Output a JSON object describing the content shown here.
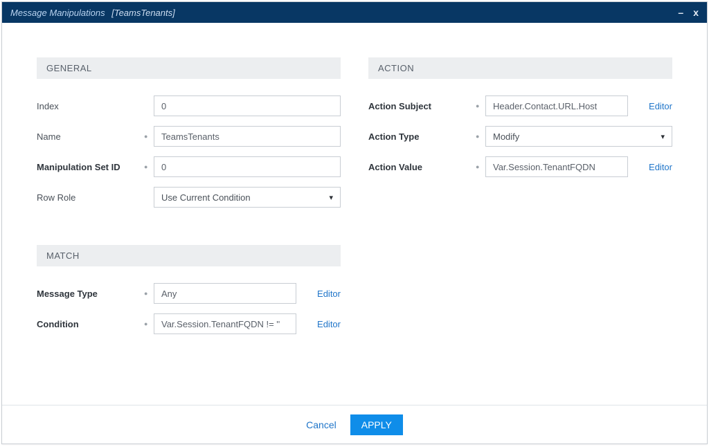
{
  "window": {
    "title": "Message Manipulations",
    "name": "[TeamsTenants]"
  },
  "sections": {
    "general": {
      "header": "GENERAL",
      "index_label": "Index",
      "index_value": "0",
      "name_label": "Name",
      "name_value": "TeamsTenants",
      "manip_id_label": "Manipulation Set ID",
      "manip_id_value": "0",
      "row_role_label": "Row Role",
      "row_role_value": "Use Current Condition"
    },
    "match": {
      "header": "MATCH",
      "message_type_label": "Message Type",
      "message_type_value": "Any",
      "condition_label": "Condition",
      "condition_value": "Var.Session.TenantFQDN != ''"
    },
    "action": {
      "header": "ACTION",
      "subject_label": "Action Subject",
      "subject_value": "Header.Contact.URL.Host",
      "type_label": "Action Type",
      "type_value": "Modify",
      "value_label": "Action Value",
      "value_value": "Var.Session.TenantFQDN"
    }
  },
  "links": {
    "editor": "Editor"
  },
  "footer": {
    "cancel": "Cancel",
    "apply": "APPLY"
  }
}
